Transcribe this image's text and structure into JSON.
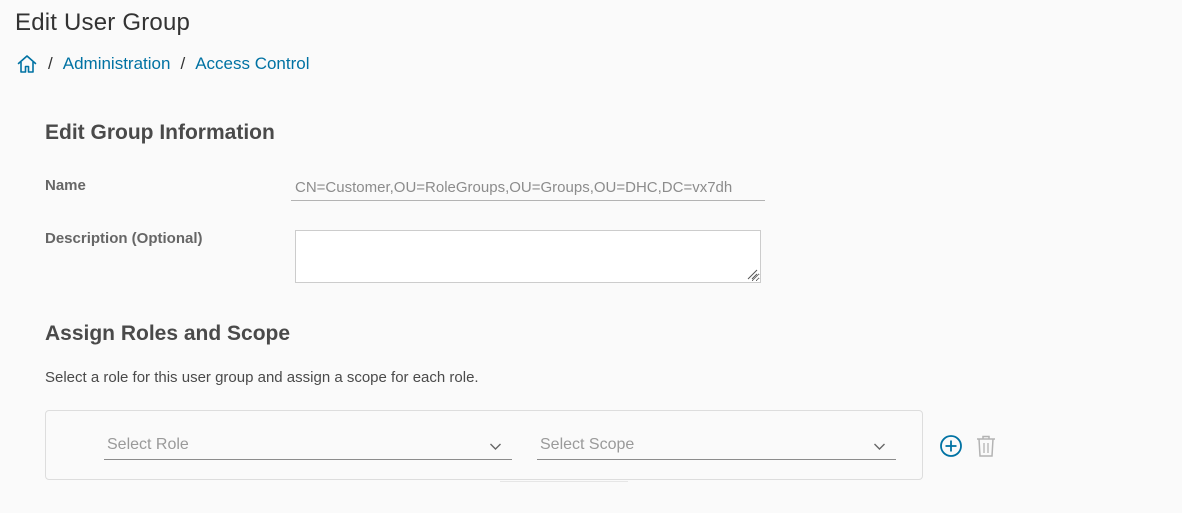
{
  "page": {
    "title": "Edit User Group"
  },
  "breadcrumb": {
    "home_icon": "home-icon",
    "separator": "/",
    "items": [
      {
        "label": "Administration"
      },
      {
        "label": "Access Control"
      }
    ]
  },
  "group_info": {
    "heading": "Edit Group Information",
    "name_label": "Name",
    "name_value": "CN=Customer,OU=RoleGroups,OU=Groups,OU=DHC,DC=vx7dh",
    "description_label": "Description (Optional)",
    "description_value": ""
  },
  "roles": {
    "heading": "Assign Roles and Scope",
    "helper": "Select a role for this user group and assign a scope for each role.",
    "rows": [
      {
        "role_placeholder": "Select Role",
        "scope_placeholder": "Select Scope"
      }
    ],
    "add_icon": "plus-circle-icon",
    "delete_icon": "trash-icon"
  },
  "colors": {
    "link": "#0072a3",
    "background": "#fafafa",
    "heading": "#4a4a4a"
  }
}
